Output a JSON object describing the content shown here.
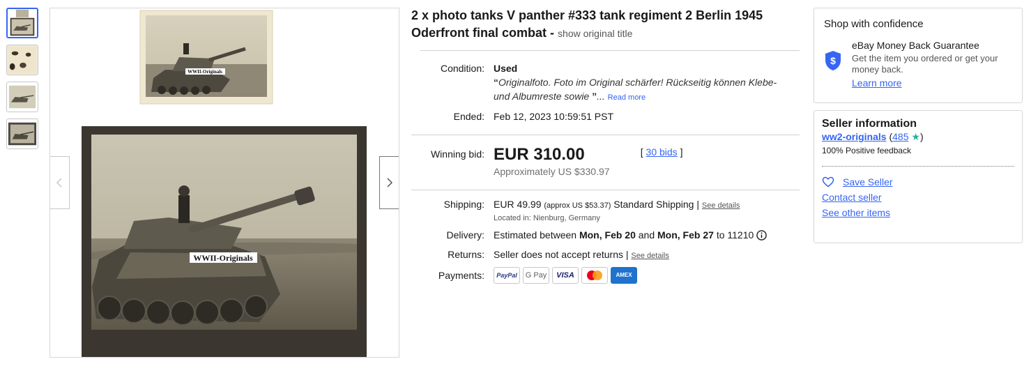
{
  "thumbnails": [
    {
      "label": "photo-1"
    },
    {
      "label": "photo-2"
    },
    {
      "label": "photo-3"
    },
    {
      "label": "photo-4"
    }
  ],
  "main_image": {
    "watermark_top": "WWII-Originals",
    "watermark_bottom": "WWII-Originals"
  },
  "listing": {
    "title": "2 x photo tanks V panther #333 tank regiment 2 Berlin 1945 Oderfront final combat -",
    "show_original": "show original title",
    "condition_label": "Condition:",
    "condition_value": "Used",
    "condition_quote_open": "“",
    "condition_quote": "Originalfoto. Foto im Original schärfer! Rückseitig können Klebe- und Albumreste sowie",
    "condition_quote_close": "”",
    "condition_ellipsis": "...",
    "read_more": "Read more",
    "ended_label": "Ended:",
    "ended_value": "Feb 12, 2023 10:59:51 PST",
    "winning_bid_label": "Winning bid:",
    "price": "EUR 310.00",
    "approx_price": "Approximately US $330.97",
    "bids_open": "[",
    "bids_link": "30 bids",
    "bids_close": "]",
    "shipping_label": "Shipping:",
    "shipping_price": "EUR 49.99",
    "shipping_approx": "(approx US $53.37)",
    "shipping_method": "Standard Shipping |",
    "shipping_details": "See details",
    "located_in": "Located in: Nienburg, Germany",
    "delivery_label": "Delivery:",
    "delivery_prefix": "Estimated between",
    "delivery_start": "Mon, Feb 20",
    "delivery_and": "and",
    "delivery_end": "Mon, Feb 27",
    "delivery_to": "to 11210",
    "returns_label": "Returns:",
    "returns_value": "Seller does not accept returns |",
    "returns_details": "See details",
    "payments_label": "Payments:",
    "payment_methods": [
      "PayPal",
      "G Pay",
      "VISA",
      "Mastercard",
      "AMEX"
    ]
  },
  "confidence": {
    "heading": "Shop with confidence",
    "guarantee_title": "eBay Money Back Guarantee",
    "guarantee_text": "Get the item you ordered or get your money back.",
    "learn_more": "Learn more"
  },
  "seller": {
    "heading": "Seller information",
    "name": "ww2-originals",
    "score_open": "(",
    "score": "485",
    "score_close": ")",
    "feedback": "100% Positive feedback",
    "save_seller": "Save Seller",
    "contact": "Contact seller",
    "other_items": "See other items"
  },
  "colors": {
    "link": "#3665f3",
    "text": "#191919",
    "star": "#2ab0a0",
    "shield": "#3665f3"
  }
}
